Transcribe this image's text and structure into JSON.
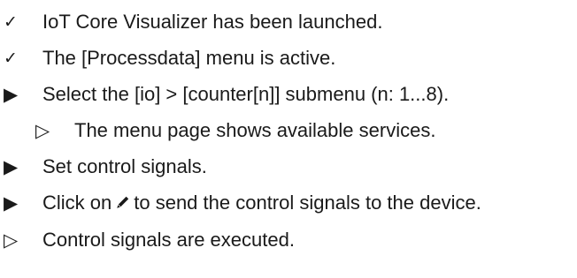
{
  "steps": [
    {
      "marker": "check-icon",
      "text": "IoT Core Visualizer has been launched."
    },
    {
      "marker": "check-icon",
      "text": "The [Processdata] menu is active."
    },
    {
      "marker": "filled-arrow-icon",
      "text": "Select the [io] > [counter[n]] submenu (n: 1...8)."
    },
    {
      "marker": "outline-arrow-icon",
      "text": "The menu page shows available services."
    },
    {
      "marker": "filled-arrow-icon",
      "text": "Set control signals."
    },
    {
      "marker": "filled-arrow-icon",
      "text_before": "Click on",
      "inline_icon": "pencil-icon",
      "text_after": "to send the control signals to the device."
    },
    {
      "marker": "outline-arrow-icon",
      "text": "Control signals are executed."
    }
  ],
  "colors": {
    "text": "#1a1a1a",
    "background": "#ffffff"
  }
}
